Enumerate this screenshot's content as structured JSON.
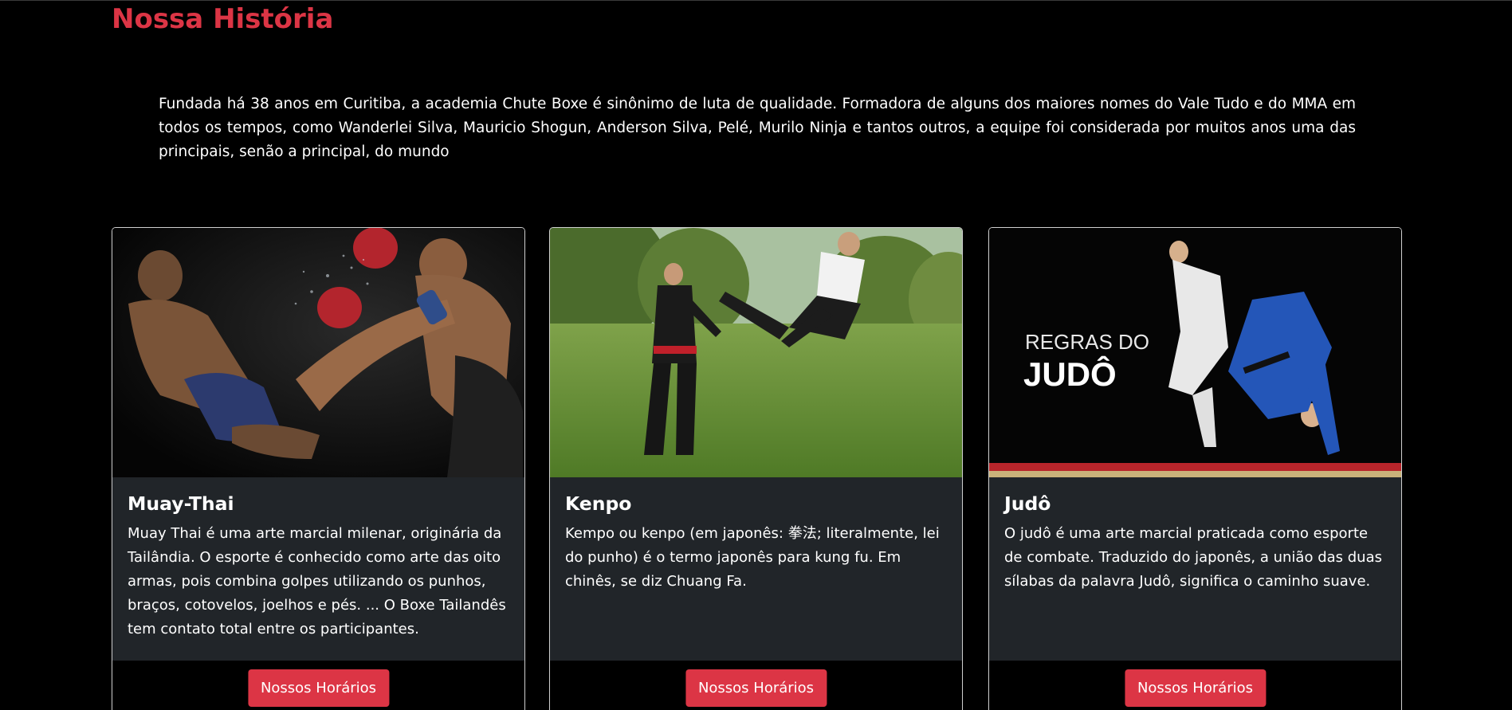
{
  "history": {
    "title": "Nossa História",
    "text": "Fundada há 38 anos em Curitiba, a academia Chute Boxe é sinônimo de luta de qualidade. Formadora de alguns dos maiores nomes do Vale Tudo e do MMA em todos os tempos, como Wanderlei Silva, Mauricio Shogun, Anderson Silva, Pelé, Murilo Ninja e tantos outros, a equipe foi considerada por muitos anos uma das principais, senão a principal, do mundo"
  },
  "cards": [
    {
      "title": "Muay-Thai",
      "text": "Muay Thai é uma arte marcial milenar, originária da Tailândia. O esporte é conhecido como arte das oito armas, pois combina golpes utilizando os punhos, braços, cotovelos, joelhos e pés. ... O Boxe Tailandês tem contato total entre os participantes.",
      "button": "Nossos Horários",
      "image_icon": "muay-thai-photo"
    },
    {
      "title": "Kenpo",
      "text": "Kempo ou kenpo (em japonês: 拳法; literalmente, lei do punho) é o termo japonês para kung fu. Em chinês, se diz Chuang Fa.",
      "button": "Nossos Horários",
      "image_icon": "kenpo-photo"
    },
    {
      "title": "Judô",
      "text": "O judô é uma arte marcial praticada como esporte de combate. Traduzido do japonês, a união das duas sílabas da palavra Judô, significa o caminho suave.",
      "button": "Nossos Horários",
      "image_icon": "judo-photo",
      "image_caption_line1": "REGRAS DO",
      "image_caption_line2": "JUDÔ"
    }
  ],
  "colors": {
    "accent": "#dc3545",
    "card_body": "#212529",
    "background": "#000000"
  }
}
